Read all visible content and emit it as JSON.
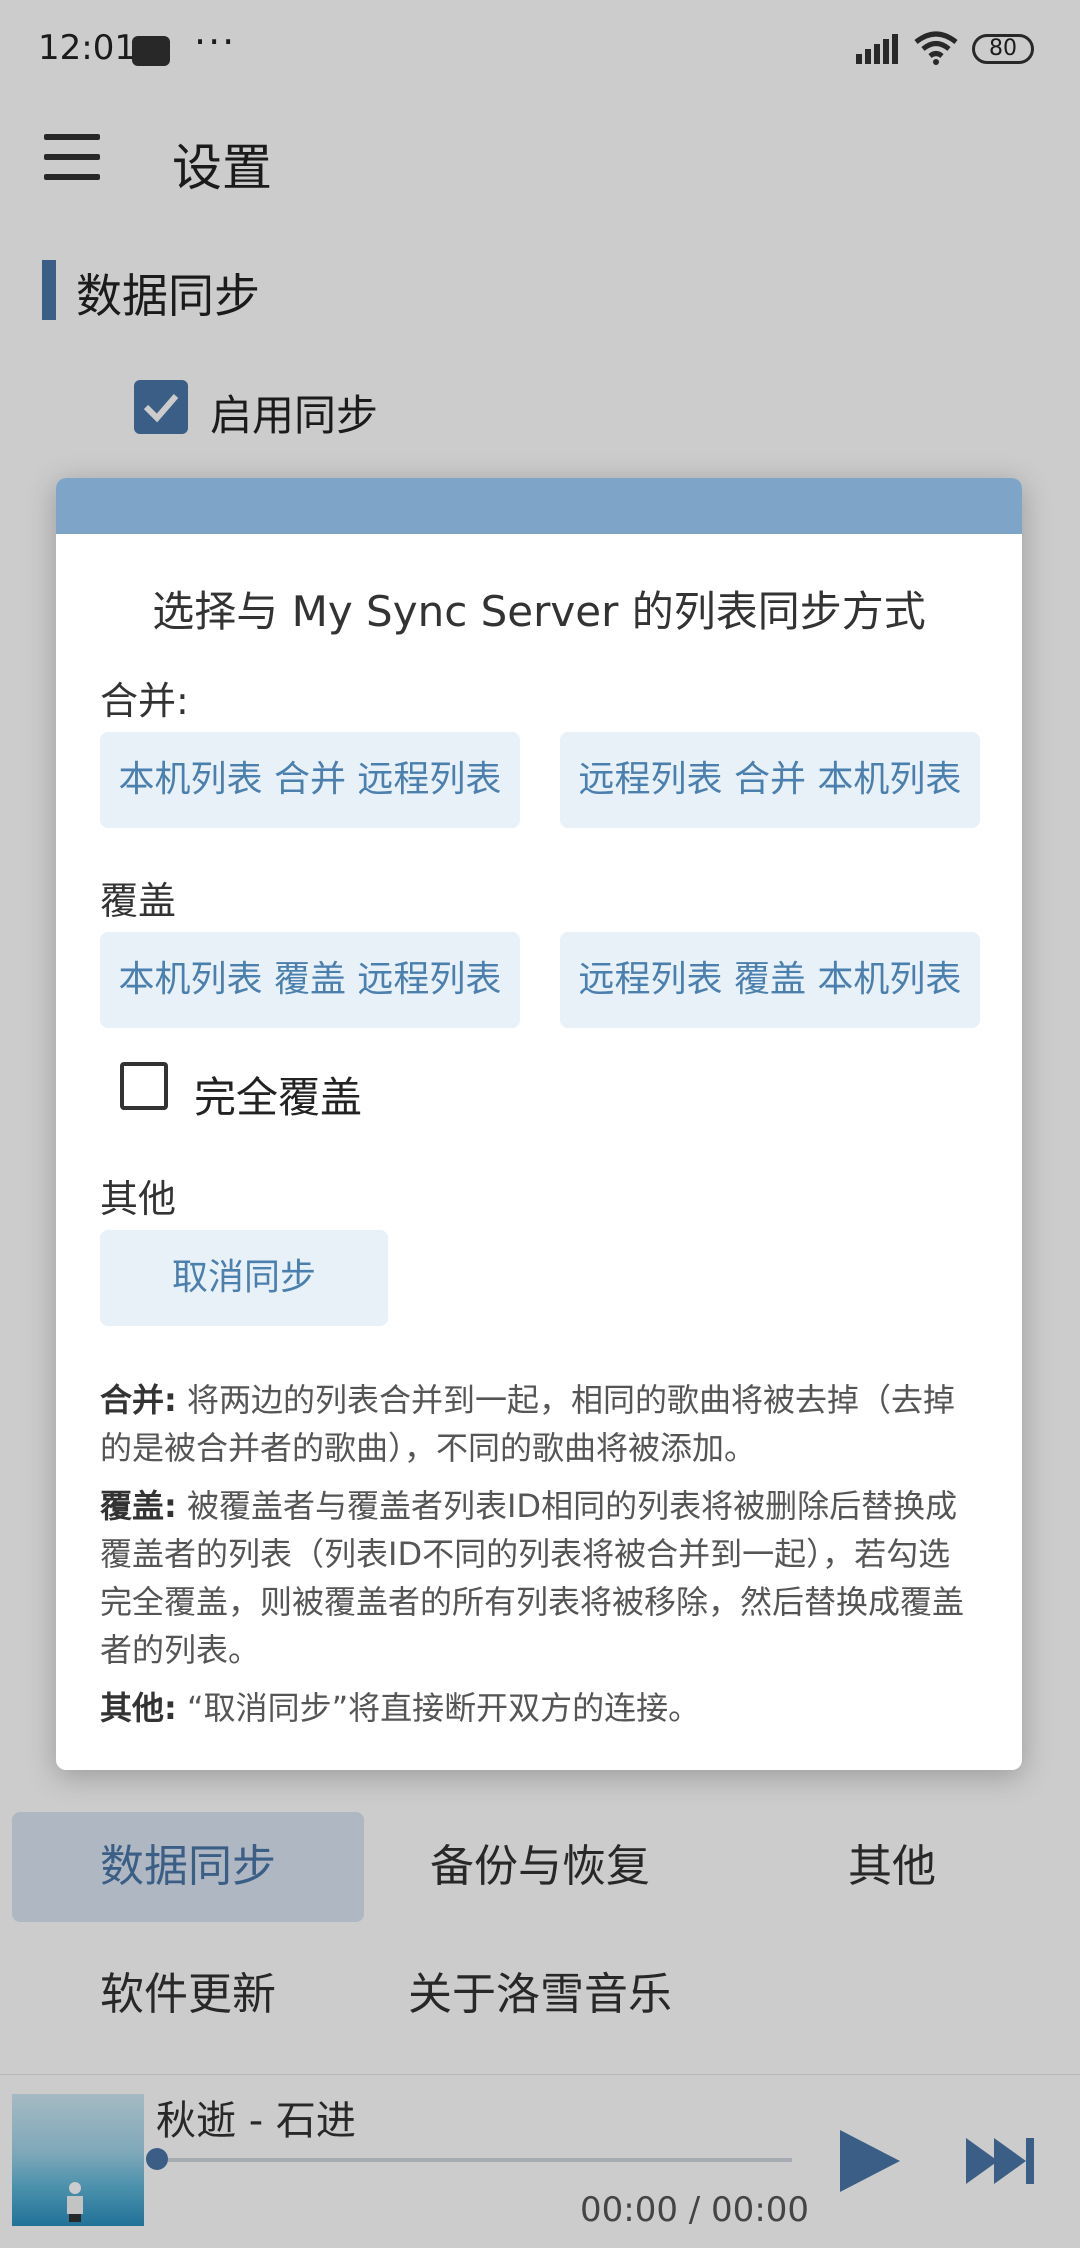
{
  "status_bar": {
    "time": "12:01",
    "battery": "80"
  },
  "header": {
    "title": "设置"
  },
  "section": {
    "title": "数据同步",
    "enable_sync_label": "启用同步"
  },
  "dialog": {
    "title": "选择与 My Sync Server 的列表同步方式",
    "merge_label": "合并:",
    "merge_local_remote": "本机列表 合并 远程列表",
    "merge_remote_local": "远程列表 合并 本机列表",
    "cover_label": "覆盖",
    "cover_local_remote": "本机列表 覆盖 远程列表",
    "cover_remote_local": "远程列表 覆盖 本机列表",
    "full_cover_label": "完全覆盖",
    "other_label": "其他",
    "cancel_sync": "取消同步",
    "desc": {
      "merge_term": "合并:",
      "merge_text": " 将两边的列表合并到一起，相同的歌曲将被去掉（去掉的是被合并者的歌曲），不同的歌曲将被添加。",
      "cover_term": "覆盖:",
      "cover_text": " 被覆盖者与覆盖者列表ID相同的列表将被删除后替换成覆盖者的列表（列表ID不同的列表将被合并到一起），若勾选完全覆盖，则被覆盖者的所有列表将被移除，然后替换成覆盖者的列表。",
      "other_term": "其他:",
      "other_text": " “取消同步”将直接断开双方的连接。"
    }
  },
  "settings_nav": [
    {
      "label": "数据同步",
      "active": true
    },
    {
      "label": "备份与恢复"
    },
    {
      "label": "其他"
    },
    {
      "label": "软件更新"
    },
    {
      "label": "关于洛雪音乐"
    }
  ],
  "player": {
    "song": "秋逝 - 石进",
    "time": "00:00 / 00:00",
    "progress": 0
  },
  "colors": {
    "accent": "#4a76a8",
    "dialog_header": "#7ea5c8",
    "button_bg": "#e8f0f8"
  }
}
